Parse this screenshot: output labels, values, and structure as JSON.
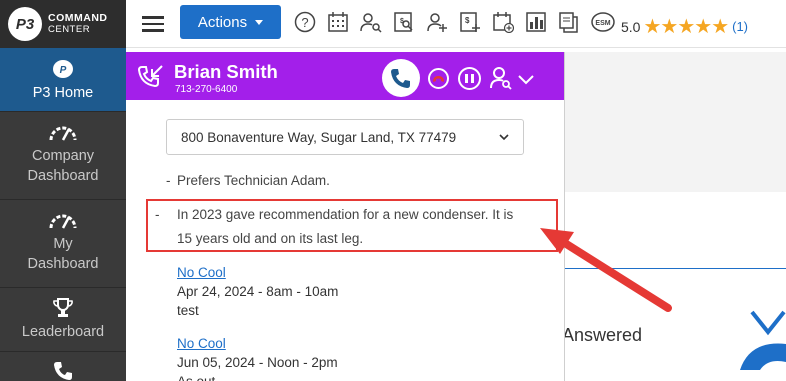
{
  "sidebar": {
    "logo_mark": "P3",
    "logo_title": "COMMAND",
    "logo_subtitle": "CENTER",
    "items": [
      {
        "label": "P3 Home"
      },
      {
        "label": "Company\nDashboard"
      },
      {
        "label": "My\nDashboard"
      },
      {
        "label": "Leaderboard"
      }
    ]
  },
  "topbar": {
    "actions_label": "Actions",
    "esm_label": "ESM",
    "rating_value": "5.0",
    "stars": "★★★★★",
    "rating_count": "(1)",
    "icons": [
      "help-icon",
      "calendar-icon",
      "person-search-icon",
      "document-search-icon",
      "add-person-icon",
      "add-invoice-icon",
      "add-calendar-icon",
      "bar-chart-icon",
      "copy-icon",
      "esm-icon"
    ]
  },
  "call": {
    "caller_name": "Brian Smith",
    "caller_phone": "713-270-6400",
    "address": "800 Bonaventure Way, Sugar Land, TX 77479",
    "notes": [
      "Prefers Technician Adam.",
      "In 2023 gave recommendation for a new condenser. It is 15 years old and on its last leg."
    ],
    "appointments": [
      {
        "type": "No Cool",
        "datetime": "Apr 24, 2024 - 8am - 10am",
        "note": "test"
      },
      {
        "type": "No Cool",
        "datetime": "Jun 05, 2024 - Noon - 2pm",
        "note": "As out"
      }
    ]
  },
  "background": {
    "text": "Answered"
  },
  "colors": {
    "sidebar_bg": "#3a3a3a",
    "active_nav": "#1e5a8e",
    "call_header": "#a31fea",
    "actions_button": "#1e6fc8",
    "highlight": "#e53935",
    "stars": "#f5a623"
  }
}
